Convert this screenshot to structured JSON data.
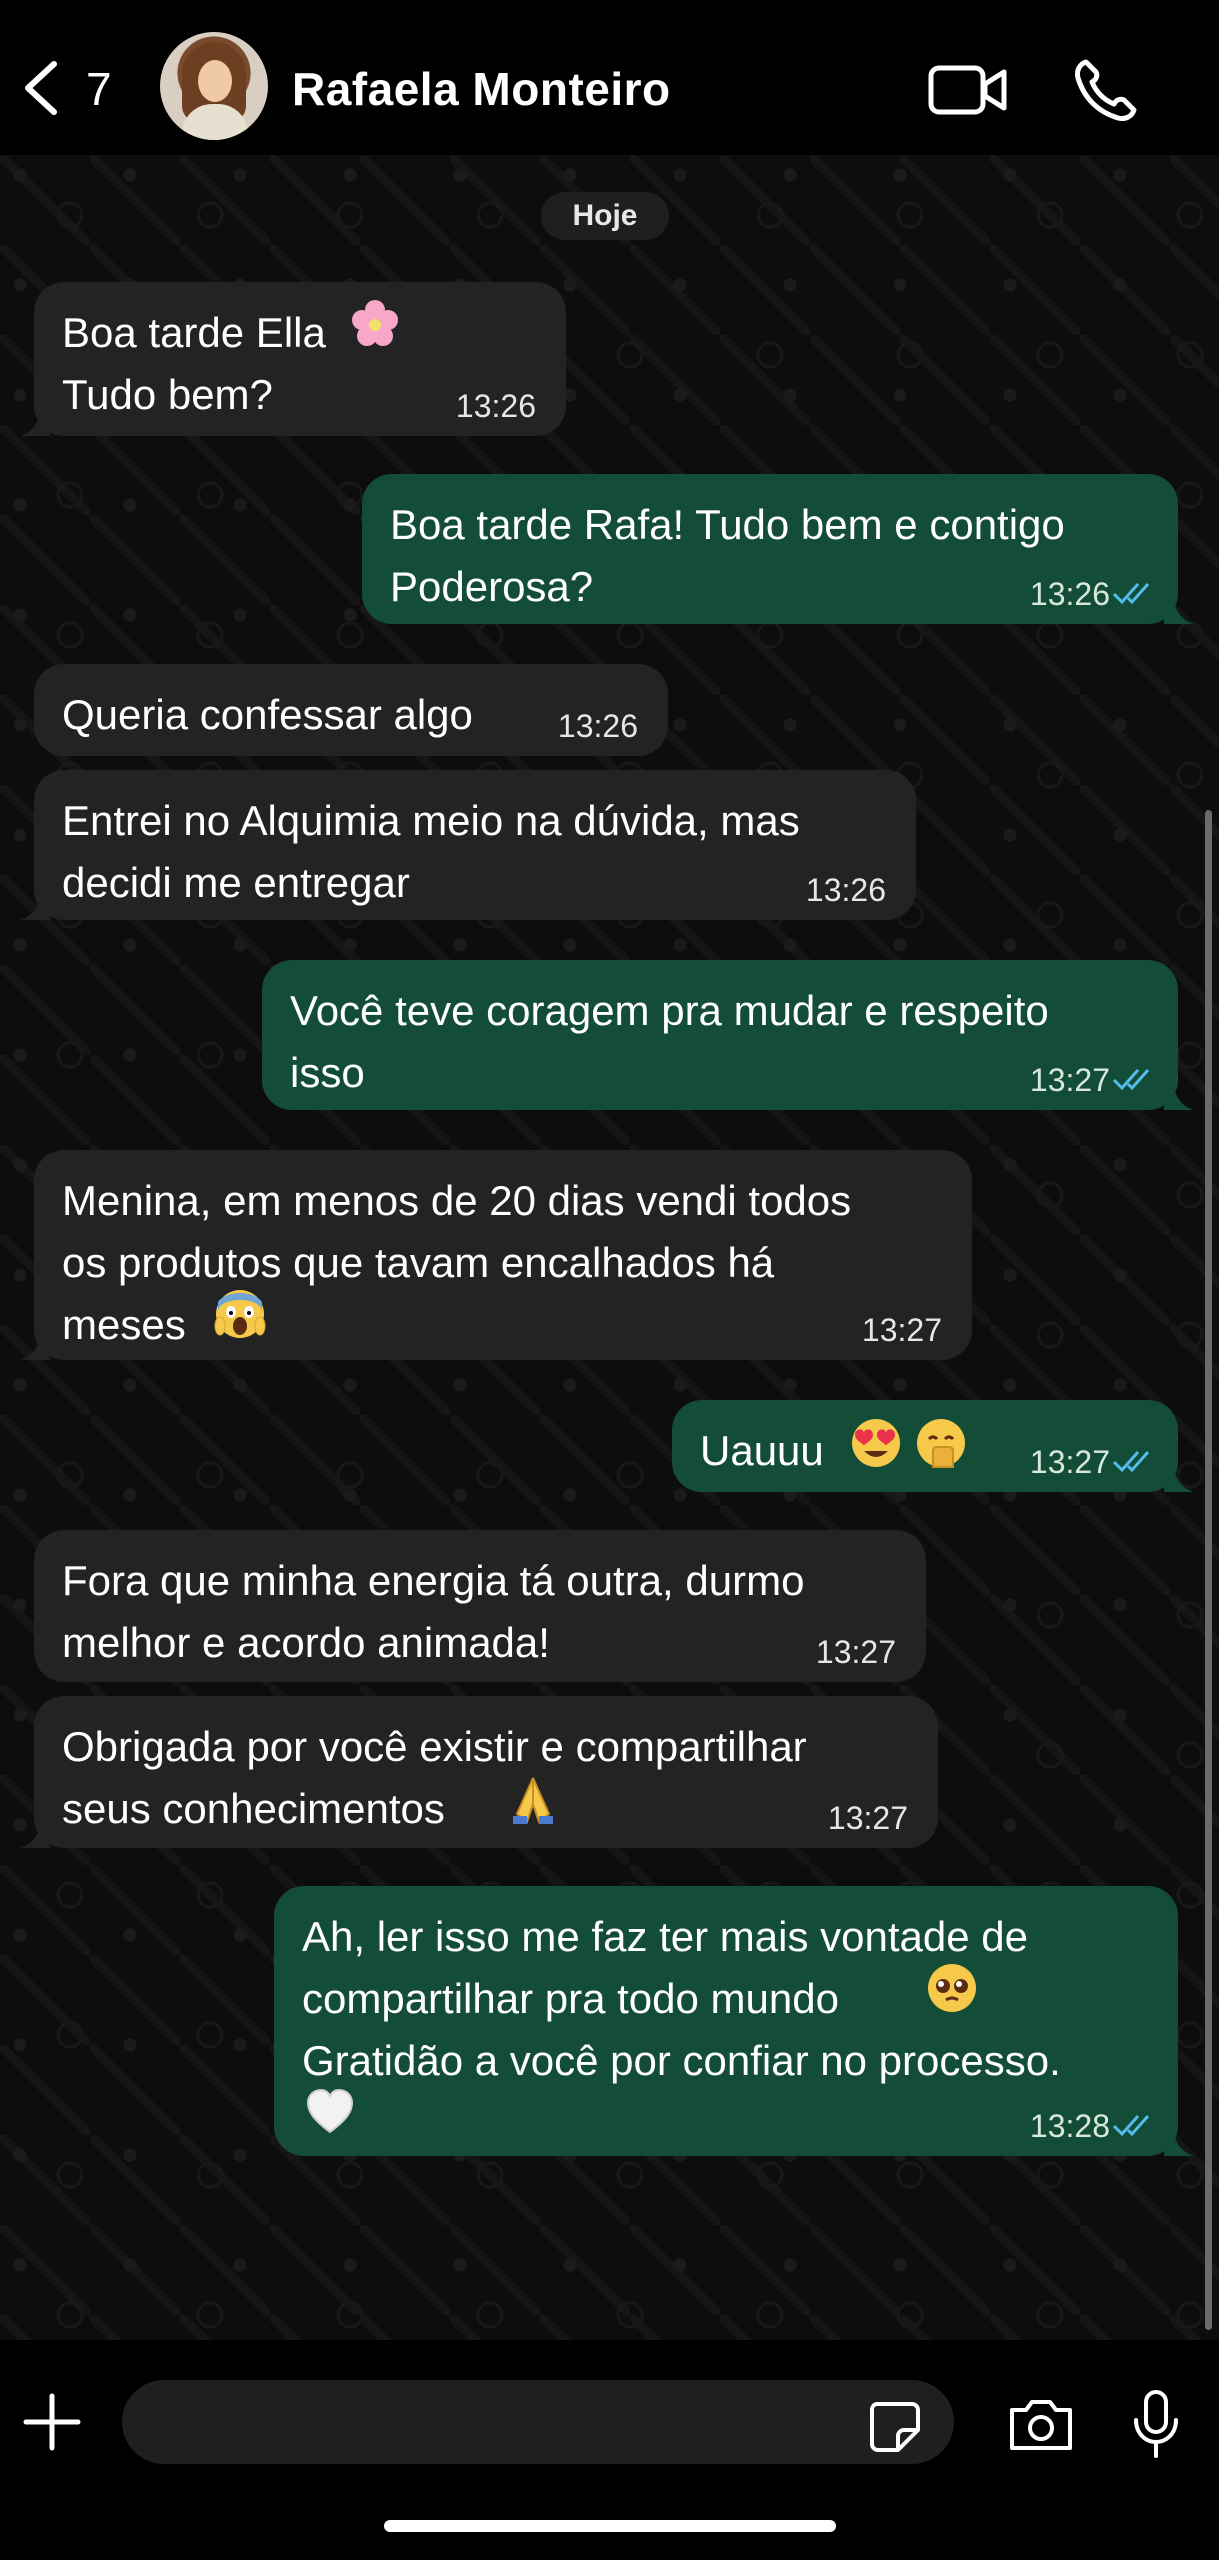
{
  "header": {
    "back_count": "7",
    "contact_name": "Rafaela Monteiro"
  },
  "chat": {
    "date_label": "Hoje",
    "messages": [
      {
        "direction": "in",
        "text": "Boa tarde Ella\nTudo bem?",
        "emoji": "cherry-blossom",
        "time": "13:26"
      },
      {
        "direction": "out",
        "text": "Boa tarde Rafa! Tudo bem e contigo\nPoderosa?",
        "time": "13:26",
        "status": "read"
      },
      {
        "direction": "in",
        "text": "Queria confessar algo",
        "time": "13:26"
      },
      {
        "direction": "in",
        "text": "Entrei no Alquimia meio na dúvida, mas\ndecidi me entregar",
        "time": "13:26"
      },
      {
        "direction": "out",
        "text": "Você teve coragem pra mudar e respeito\nisso",
        "time": "13:27",
        "status": "read"
      },
      {
        "direction": "in",
        "text": "Menina, em menos de 20 dias vendi todos\nos produtos que tavam encalhados há\nmeses",
        "emoji": "screaming-face",
        "time": "13:27"
      },
      {
        "direction": "out",
        "text": "Uauuu",
        "emoji": "heart-eyes + hand-over-mouth",
        "time": "13:27",
        "status": "read"
      },
      {
        "direction": "in",
        "text": "Fora que minha energia tá outra, durmo\nmelhor e acordo animada!",
        "time": "13:27"
      },
      {
        "direction": "in",
        "text": "Obrigada por você existir e compartilhar\nseus conhecimentos",
        "emoji": "folded-hands",
        "time": "13:27"
      },
      {
        "direction": "out",
        "text": "Ah, ler isso me faz ter mais vontade de\ncompartilhar pra todo mundo\nGratidão a você por confiar no processo.",
        "emoji": "pleading-face + white-heart",
        "time": "13:28",
        "status": "read"
      }
    ]
  },
  "input": {
    "placeholder": "",
    "value": ""
  },
  "colors": {
    "incoming_bubble": "#232323",
    "outgoing_bubble": "#144d37",
    "read_ticks": "#53bdeb",
    "background": "#0d0d0d"
  },
  "icons": [
    "back-chevron-icon",
    "video-call-icon",
    "voice-call-icon",
    "plus-icon",
    "sticker-icon",
    "camera-icon",
    "microphone-icon"
  ]
}
